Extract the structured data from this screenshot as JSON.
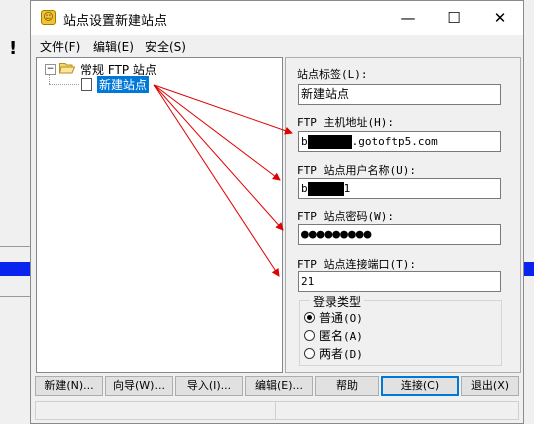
{
  "window": {
    "title": "站点设置新建站点",
    "controls": {
      "minimize": "—",
      "maximize": "☐",
      "close": "✕"
    }
  },
  "menu": [
    "文件(F)",
    "编辑(E)",
    "安全(S)"
  ],
  "tree": {
    "root_expander": "−",
    "root": "常规 FTP 站点",
    "child": "新建站点"
  },
  "fields": {
    "site_label": {
      "label": "站点标签(L):",
      "value": "新建站点"
    },
    "host": {
      "label": "FTP 主机地址(H):",
      "value_prefix": "b",
      "value_suffix": ".gotoftp5.com"
    },
    "user": {
      "label": "FTP 站点用户名称(U):",
      "value_prefix": "b",
      "value_suffix": "1"
    },
    "password": {
      "label": "FTP 站点密码(W):",
      "value": "●●●●●●●●●"
    },
    "port": {
      "label": "FTP 站点连接端口(T):",
      "value": "21"
    }
  },
  "login_type": {
    "title": "登录类型",
    "options": [
      {
        "label": "普通",
        "key": "(O)",
        "selected": true
      },
      {
        "label": "匿名",
        "key": "(A)",
        "selected": false
      },
      {
        "label": "两者",
        "key": "(D)",
        "selected": false
      }
    ]
  },
  "buttons": [
    "新建(N)...",
    "向导(W)...",
    "导入(I)...",
    "编辑(E)...",
    "帮助",
    "连接(C)",
    "退出(X)"
  ],
  "colors": {
    "selection": "#0078d7",
    "arrow": "#e00000",
    "background_bar": "#0a24f0"
  },
  "background_icon": "warning-exclamation-icon"
}
